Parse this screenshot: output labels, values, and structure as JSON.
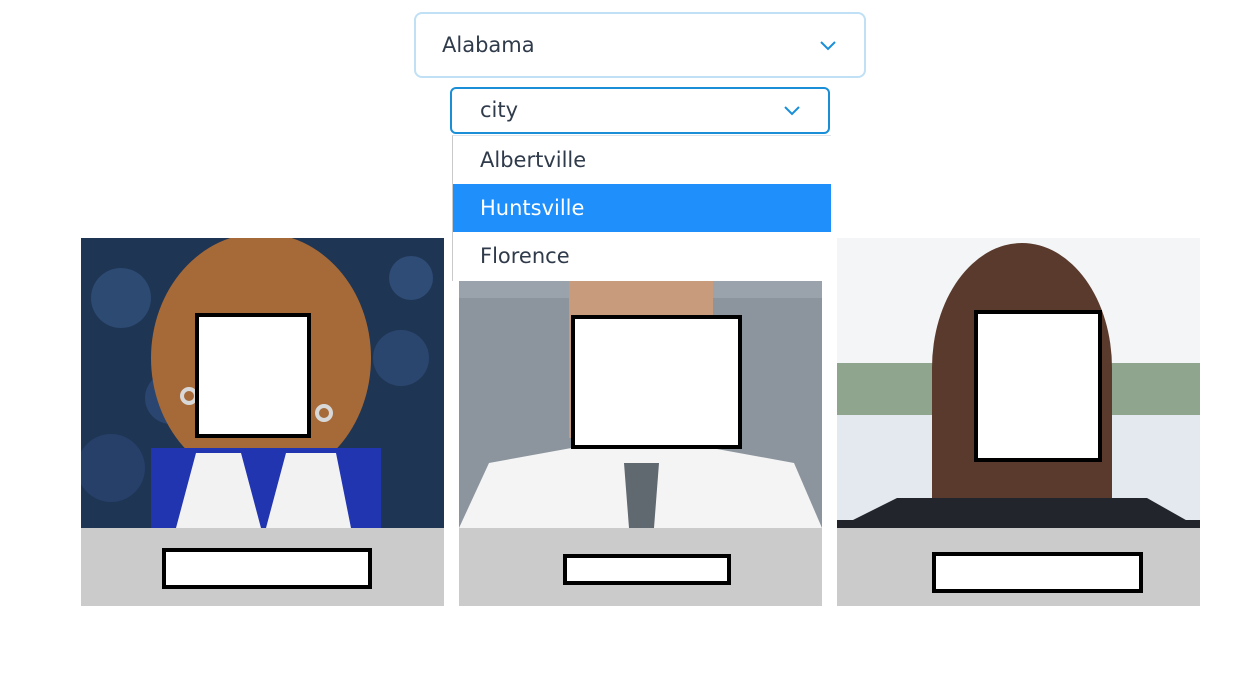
{
  "state_dropdown": {
    "value": "Alabama",
    "icon": "chevron-down-icon",
    "color": "#1a8fd8"
  },
  "city_dropdown": {
    "value": "city",
    "icon": "chevron-down-icon",
    "options": [
      "Albertville",
      "Huntsville",
      "Florence"
    ],
    "highlighted_index": 1,
    "highlight_color": "#1e8ffb"
  },
  "cards": [
    {
      "photo": "woman-portrait-blue-jacket"
    },
    {
      "photo": "man-portrait-white-shirt-tie"
    },
    {
      "photo": "woman-portrait-lake-background"
    }
  ],
  "colors": {
    "caption_bg": "#cbcbcb",
    "redaction": "#000000"
  }
}
